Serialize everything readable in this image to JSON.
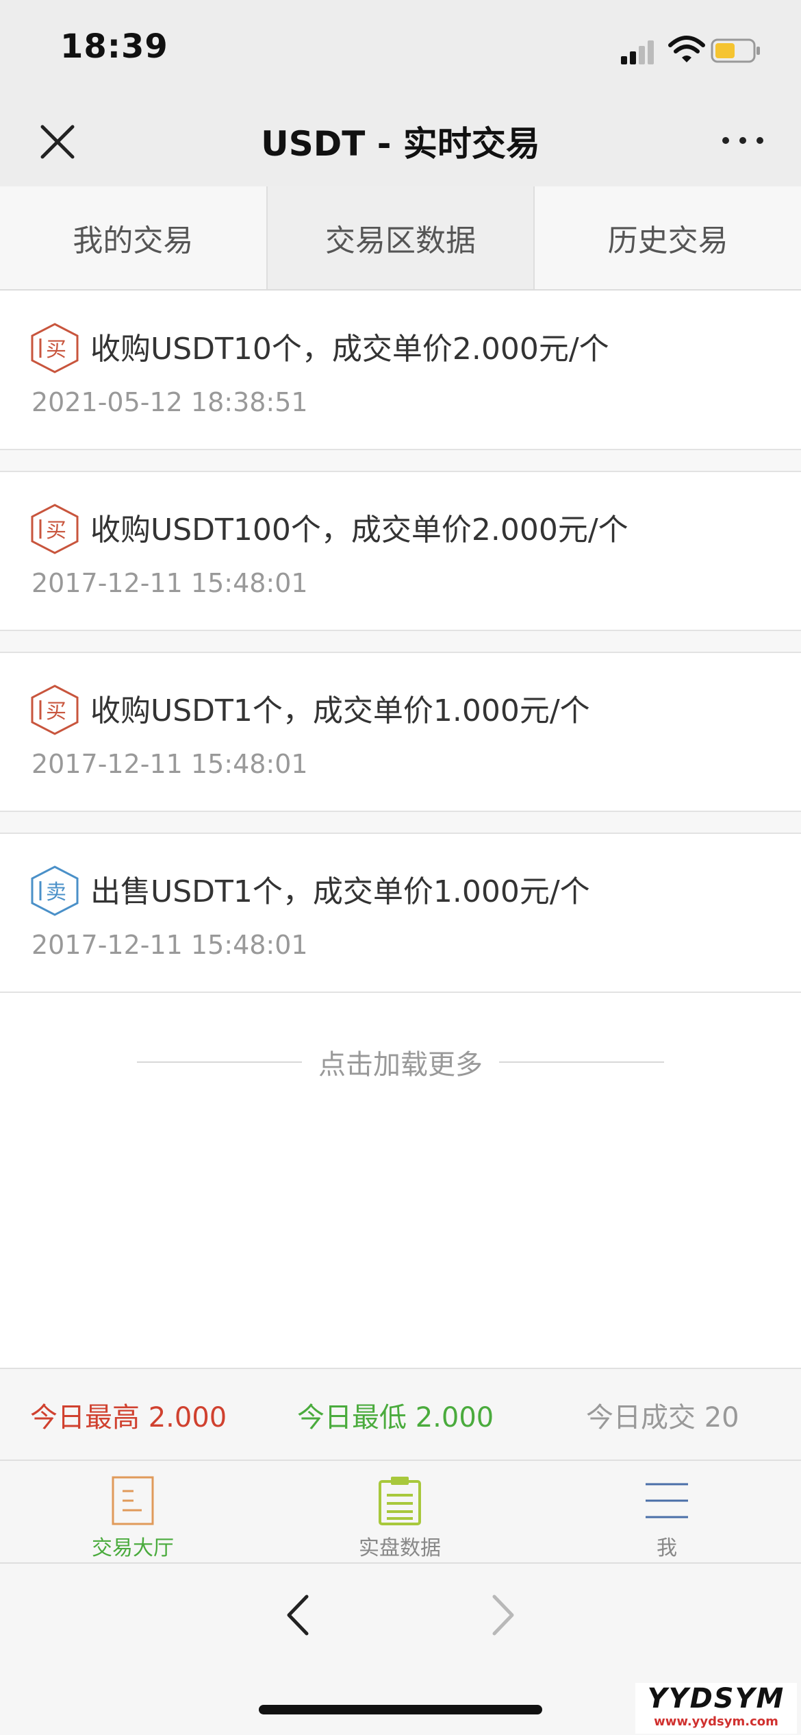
{
  "status_bar": {
    "time": "18:39"
  },
  "nav": {
    "title": "USDT - 实时交易"
  },
  "tabs": [
    {
      "label": "我的交易"
    },
    {
      "label": "交易区数据",
      "active": true
    },
    {
      "label": "历史交易"
    }
  ],
  "records": [
    {
      "type": "buy",
      "icon_char": "买",
      "text": "收购USDT10个，成交单价2.000元/个",
      "time": "2021-05-12 18:38:51"
    },
    {
      "type": "buy",
      "icon_char": "买",
      "text": "收购USDT100个，成交单价2.000元/个",
      "time": "2017-12-11 15:48:01"
    },
    {
      "type": "buy",
      "icon_char": "买",
      "text": "收购USDT1个，成交单价1.000元/个",
      "time": "2017-12-11 15:48:01"
    },
    {
      "type": "sell",
      "icon_char": "卖",
      "text": "出售USDT1个，成交单价1.000元/个",
      "time": "2017-12-11 15:48:01"
    }
  ],
  "load_more": "点击加载更多",
  "stats": {
    "high": "今日最高 2.000",
    "low": "今日最低 2.000",
    "volume": "今日成交 20"
  },
  "bottom_tabs": [
    {
      "label": "交易大厅",
      "icon": "document-icon"
    },
    {
      "label": "实盘数据",
      "icon": "clipboard-icon"
    },
    {
      "label": "我",
      "icon": "menu-icon"
    }
  ],
  "watermark": {
    "title": "YYDSYM",
    "url": "www.yydsym.com"
  },
  "colors": {
    "buy": "#c8553d",
    "sell": "#4a90c8",
    "high": "#d0412f",
    "low": "#4aab3d",
    "active_tab": "#4aab3d"
  }
}
